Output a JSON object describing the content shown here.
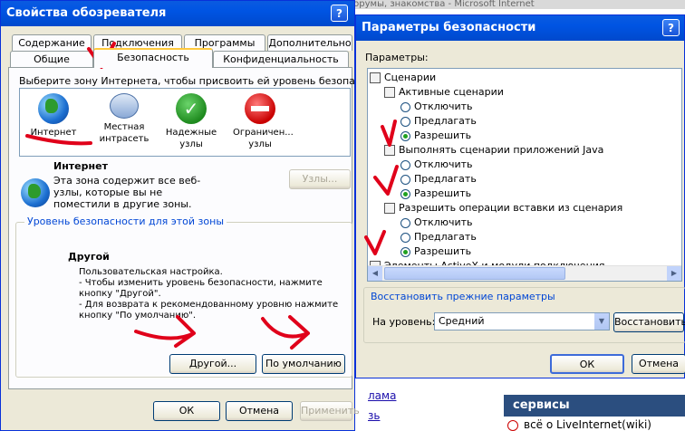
{
  "background_page": {
    "title_fragment": "ain, форумы, знакомства - Microsoft Internet",
    "side_links": [
      "лама",
      "зь"
    ],
    "services_header": "сервисы",
    "services_link": "всё о LiveInternet(wiki)"
  },
  "internet_options": {
    "title": "Свойства обозревателя",
    "help_btn": "?",
    "close_btn": "X",
    "tabs_back": [
      "Содержание",
      "Подключения",
      "Программы",
      "Дополнительно"
    ],
    "tabs_front": [
      "Общие",
      "Безопасность",
      "Конфиденциальность"
    ],
    "zone_prompt": "Выберите зону Интернета, чтобы присвоить ей уровень безопасности.",
    "zones": [
      {
        "label": "Интернет",
        "icon": "globe-icon"
      },
      {
        "label": "Местная интрасеть",
        "icon": "computer-icon"
      },
      {
        "label": "Надежные узлы",
        "icon": "check-icon"
      },
      {
        "label": "Ограничен... узлы",
        "icon": "restricted-icon"
      }
    ],
    "selected_zone_title": "Интернет",
    "selected_zone_desc": "Эта зона содержит все веб-узлы, которые вы не поместили в другие зоны.",
    "sites_btn": "Узлы...",
    "level_group": "Уровень безопасности для этой зоны",
    "level_name": "Другой",
    "level_desc": [
      "Пользовательская настройка.",
      "- Чтобы изменить уровень безопасности, нажмите",
      "кнопку \"Другой\".",
      "- Для возврата к рекомендованному уровню нажмите",
      "кнопку \"По умолчанию\"."
    ],
    "custom_btn": "Другой...",
    "default_btn": "По умолчанию",
    "ok_btn": "ОК",
    "cancel_btn": "Отмена",
    "apply_btn": "Применить"
  },
  "security_settings": {
    "title": "Параметры безопасности",
    "help_btn": "?",
    "params_label": "Параметры:",
    "tree": [
      {
        "type": "category",
        "text": "Сценарии"
      },
      {
        "type": "setting",
        "text": "Активные сценарии"
      },
      {
        "type": "radio",
        "text": "Отключить",
        "checked": false
      },
      {
        "type": "radio",
        "text": "Предлагать",
        "checked": false
      },
      {
        "type": "radio",
        "text": "Разрешить",
        "checked": true
      },
      {
        "type": "setting",
        "text": "Выполнять сценарии приложений Java"
      },
      {
        "type": "radio",
        "text": "Отключить",
        "checked": false
      },
      {
        "type": "radio",
        "text": "Предлагать",
        "checked": false
      },
      {
        "type": "radio",
        "text": "Разрешить",
        "checked": true
      },
      {
        "type": "setting",
        "text": "Разрешить операции вставки из сценария"
      },
      {
        "type": "radio",
        "text": "Отключить",
        "checked": false
      },
      {
        "type": "radio",
        "text": "Предлагать",
        "checked": false
      },
      {
        "type": "radio",
        "text": "Разрешить",
        "checked": true
      },
      {
        "type": "category",
        "text": "Элементы ActiveX и модули подключения"
      }
    ],
    "reset_group": "Восстановить прежние параметры",
    "level_label": "На уровень:",
    "level_value": "Средний",
    "restore_btn": "Восстановить",
    "ok_btn": "ОК",
    "cancel_btn": "Отмена"
  },
  "colors": {
    "xp_blue": "#0054e3",
    "annotation_red": "#e0001a",
    "radio_green": "#21a121"
  }
}
